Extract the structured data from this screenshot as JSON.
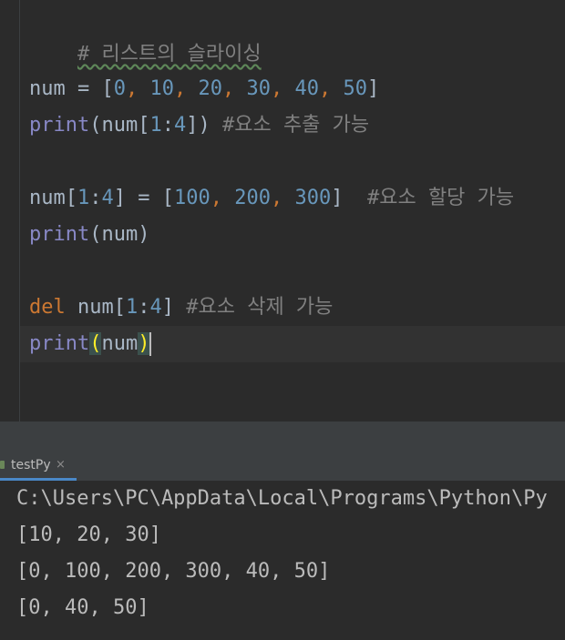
{
  "editor": {
    "comment_line": "# 리스트의 슬라이싱",
    "line_assign": {
      "var": "num",
      "op": " = [",
      "nums": [
        "0",
        "10",
        "20",
        "30",
        "40",
        "50"
      ],
      "close": "]"
    },
    "line_print_slice": {
      "func": "print",
      "args_open": "(num[",
      "start": "1",
      "colon": ":",
      "end": "4",
      "args_close": "]) ",
      "comment": "#요소 추출 가능"
    },
    "line_slice_assign": {
      "lhs_open": "num[",
      "start": "1",
      "colon": ":",
      "end": "4",
      "lhs_close": "] = [",
      "nums": [
        "100",
        "200",
        "300"
      ],
      "close": "]  ",
      "comment": "#요소 할당 가능"
    },
    "line_print": {
      "func": "print",
      "args": "(num)"
    },
    "line_del": {
      "keyword": "del",
      "target_open": " num[",
      "start": "1",
      "colon": ":",
      "end": "4",
      "target_close": "] ",
      "comment": "#요소 삭제 가능"
    },
    "line_print_cursor": {
      "func": "print",
      "paren_open": "(",
      "arg": "num",
      "paren_close": ")"
    }
  },
  "run_tab": {
    "label": "testPy",
    "close_glyph": "×",
    "icon": "python-run-icon"
  },
  "console": {
    "lines": [
      "C:\\Users\\PC\\AppData\\Local\\Programs\\Python\\Py",
      "[10, 20, 30]",
      "[0, 100, 200, 300, 40, 50]",
      "[0, 40, 50]"
    ]
  },
  "colors": {
    "background": "#2b2b2b",
    "keyword": "#cc7832",
    "builtin": "#8888c6",
    "number": "#6897bb",
    "comment": "#808080",
    "text": "#a9b7c6"
  }
}
